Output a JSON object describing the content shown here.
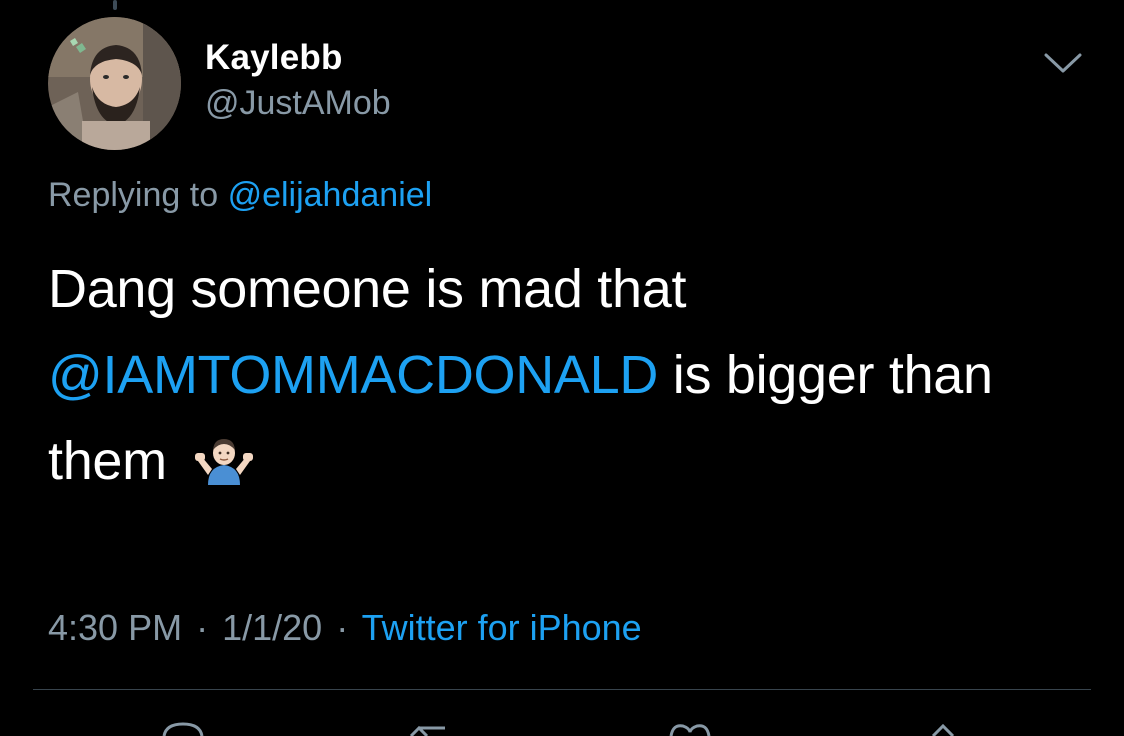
{
  "tweet": {
    "display_name": "Kaylebb",
    "handle": "@JustAMob",
    "replying_prefix": "Replying to",
    "replying_to": "@elijahdaniel",
    "text_part1": "Dang someone is mad that",
    "mention": "@IAMTOMMACDONALD",
    "text_part2": "is bigger than",
    "text_part3": "them",
    "emoji_icon": "man-shrugging-emoji",
    "time": "4:30 PM",
    "separator": "·",
    "date": "1/1/20",
    "source": "Twitter for iPhone"
  },
  "colors": {
    "background": "#000000",
    "link": "#1da1f2",
    "secondary_text": "#8899a6",
    "divider": "#38444d"
  },
  "icons": {
    "menu": "chevron-down-icon",
    "actions": [
      "reply-icon",
      "retweet-icon",
      "like-icon",
      "share-icon"
    ]
  }
}
